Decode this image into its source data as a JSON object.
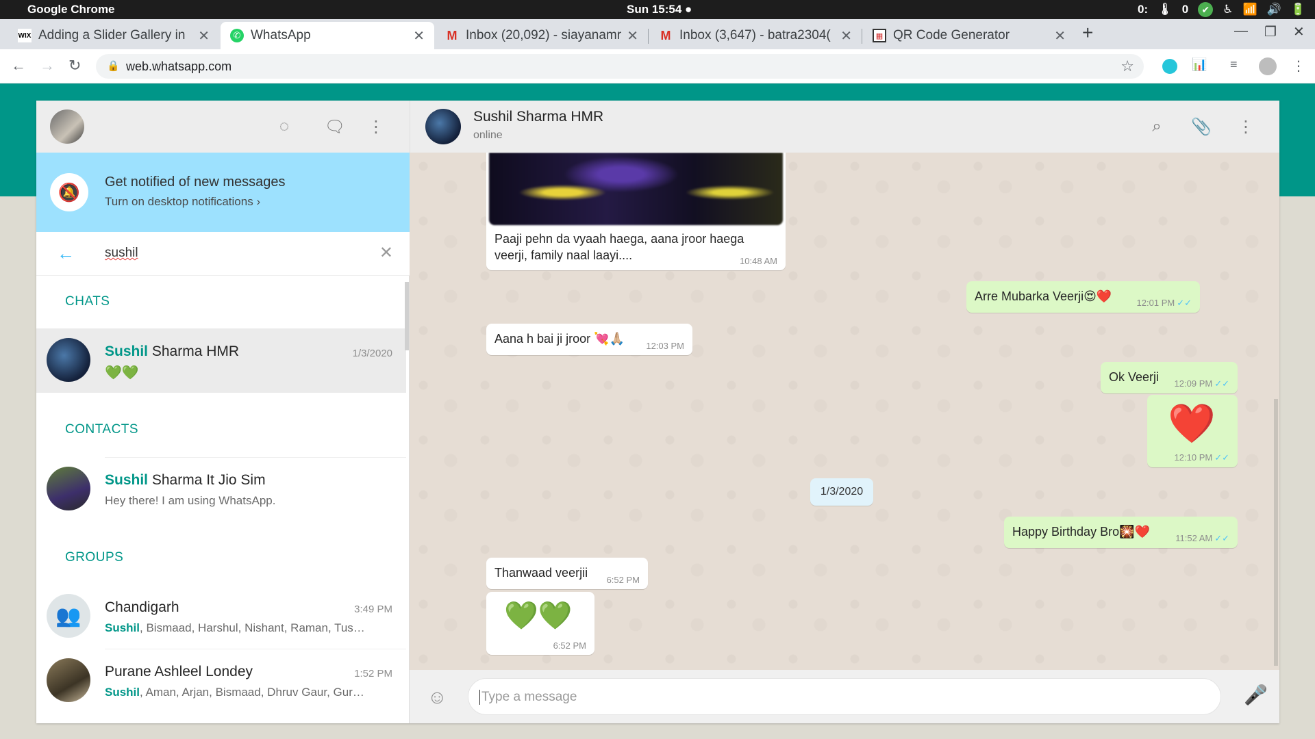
{
  "os": {
    "app_name": "Google Chrome",
    "clock": "Sun 15:54 ●",
    "tray": [
      "0:",
      "0",
      "✔",
      "♿",
      "WiFi",
      "Vol",
      "Bat"
    ]
  },
  "browser": {
    "tabs": [
      {
        "favicon": "wix",
        "title": "Adding a Slider Gallery in"
      },
      {
        "favicon": "whatsapp",
        "title": "WhatsApp"
      },
      {
        "favicon": "gmail",
        "title": "Inbox (20,092) - siayanamr"
      },
      {
        "favicon": "gmail",
        "title": "Inbox (3,647) - batra2304("
      },
      {
        "favicon": "qr",
        "title": "QR Code Generator"
      }
    ],
    "url": "web.whatsapp.com"
  },
  "left": {
    "notification": {
      "title": "Get notified of new messages",
      "subtitle": "Turn on desktop notifications ›"
    },
    "search": {
      "value": "sushil"
    },
    "sections": {
      "chats": "CHATS",
      "contacts": "CONTACTS",
      "groups": "GROUPS"
    },
    "chats": [
      {
        "highlight": "Sushil",
        "rest": " Sharma HMR",
        "time": "1/3/2020",
        "preview": "💚💚"
      }
    ],
    "contacts": [
      {
        "highlight": "Sushil",
        "rest": " Sharma It Jio Sim",
        "status": "Hey there! I am using WhatsApp."
      }
    ],
    "groups": [
      {
        "name": "Chandigarh",
        "time": "3:49 PM",
        "highlight": "Sushil",
        "members": ", Bismaad, Harshul, Nishant, Raman, Tus…"
      },
      {
        "name": "Purane Ashleel Londey",
        "time": "1:52 PM",
        "highlight": "Sushil",
        "members": ", Aman, Arjan, Bismaad, Dhruv Gaur, Gur…"
      }
    ]
  },
  "chat": {
    "contact_name": "Sushil Sharma HMR",
    "status": "online",
    "messages": [
      {
        "dir": "in",
        "text_line1": "Paaji pehn da vyaah haega, aana jroor haega",
        "text_line2": "veerji, family naal laayi....",
        "time": "10:48 AM"
      },
      {
        "dir": "out",
        "text": "Arre Mubarka  Veerji😍❤️",
        "time": "12:01 PM"
      },
      {
        "dir": "in",
        "text": "Aana h bai ji jroor 💘🙏🏼",
        "time": "12:03 PM"
      },
      {
        "dir": "out",
        "text": "Ok Veerji",
        "time": "12:09 PM"
      },
      {
        "dir": "out",
        "text": "❤️",
        "time": "12:10 PM"
      },
      {
        "dir": "out",
        "text": "Happy Birthday Bro🎇❤️",
        "time": "11:52 AM"
      },
      {
        "dir": "in",
        "text": "Thanwaad veerjii",
        "time": "6:52 PM"
      },
      {
        "dir": "in",
        "text": "💚💚",
        "time": "6:52 PM"
      }
    ],
    "date_chip": "1/3/2020",
    "composer_placeholder": "Type a message",
    "ticks": "✓✓"
  }
}
